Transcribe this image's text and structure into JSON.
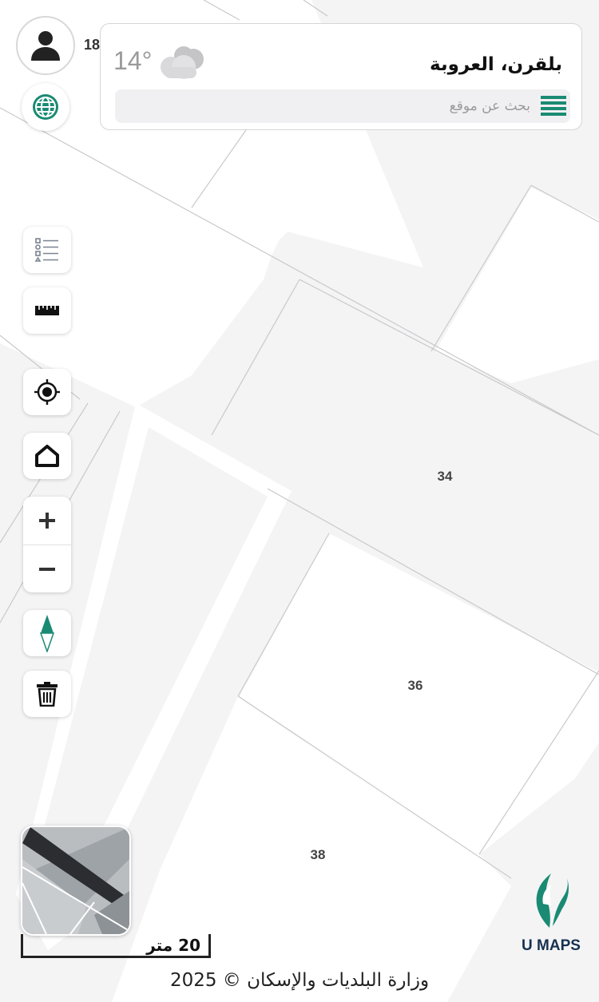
{
  "header": {
    "temperature": "14°",
    "weather_icon": "cloud-icon",
    "location": "بلقرن، العروبة",
    "search_placeholder": "بحث عن موقع",
    "avatar_count": "18"
  },
  "map": {
    "parcels": [
      "34",
      "36",
      "38"
    ],
    "scale_label": "20 متر"
  },
  "toolbar": {
    "tools": [
      "legend-icon",
      "ruler-icon",
      "locate-icon",
      "home-icon",
      "zoom-in-icon",
      "zoom-out-icon",
      "compass-icon",
      "trash-icon"
    ]
  },
  "branding": {
    "logo_text": "U MAPS",
    "accent": "#1a8a73",
    "navy": "#17314f"
  },
  "footer": {
    "copyright": "وزارة البلديات والإسكان © 2025"
  }
}
